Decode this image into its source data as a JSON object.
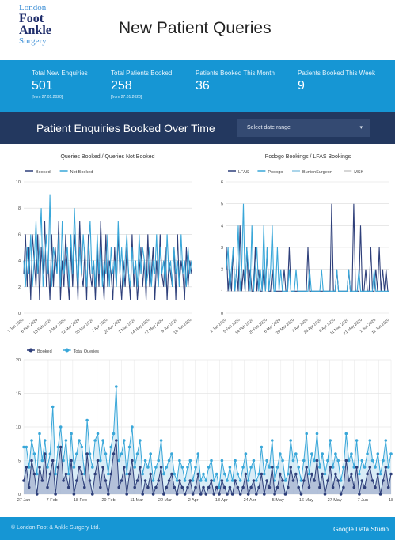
{
  "header": {
    "logo": {
      "line1": "London",
      "line2": "Foot",
      "line3": "Ankle",
      "line4": "Surgery"
    },
    "title": "New Patient Queries"
  },
  "kpis": [
    {
      "label": "Total New Enquiries",
      "value": "501",
      "sub": "[from 27.01.2020]"
    },
    {
      "label": "Total Patients Booked",
      "value": "258",
      "sub": "[from 27.01.2020]"
    },
    {
      "label": "Patients Booked This Month",
      "value": "36",
      "sub": ""
    },
    {
      "label": "Patients Booked This Week",
      "value": "9",
      "sub": ""
    }
  ],
  "banner": {
    "title": "Patient Enquiries Booked Over Time",
    "date_placeholder": "Select date range"
  },
  "footer": {
    "copyright": "© London Foot & Ankle Surgery Ltd.",
    "brand": "Google Data Studio"
  },
  "colors": {
    "dark_series": "#2e3f7a",
    "light_series": "#39a7d9",
    "kpi_bar": "#1696d4",
    "banner": "#23385f"
  },
  "chart_data": [
    {
      "type": "line",
      "title": "Queries Booked / Queries Not Booked",
      "ylim": [
        0,
        10
      ],
      "yticks": [
        0,
        2,
        4,
        6,
        8,
        10
      ],
      "xtick_labels": [
        "1 Jan 2020",
        "6 Feb 2020",
        "18 Feb 2020",
        "2 Mar 2020",
        "12 Mar 2020",
        "26 Mar 2020",
        "7 Apr 2020",
        "20 Apr 2020",
        "1 May 2020",
        "14 May 2020",
        "27 May 2020",
        "8 Jun 2020",
        "18 Jun 2020"
      ],
      "series": [
        {
          "name": "Booked",
          "color": "#2e3f7a",
          "values": [
            3,
            6,
            2,
            5,
            1,
            6,
            4,
            2,
            6,
            1,
            5,
            3,
            7,
            2,
            4,
            1,
            6,
            2,
            5,
            3,
            7,
            1,
            4,
            2,
            6,
            3,
            1,
            5,
            2,
            6,
            4,
            1,
            7,
            3,
            2,
            5,
            1,
            6,
            3,
            2,
            4,
            1,
            5,
            2,
            7,
            3,
            1,
            6,
            2,
            4,
            3,
            1,
            5,
            2,
            6,
            3,
            1,
            4,
            2,
            5,
            3,
            1,
            6,
            2,
            4,
            1,
            3,
            5,
            2,
            4,
            1,
            6,
            2,
            3,
            5,
            1,
            4,
            2,
            6,
            3,
            2,
            5,
            1,
            4,
            3,
            2,
            5,
            1,
            6,
            2,
            4,
            3,
            1,
            5,
            2,
            4,
            3
          ]
        },
        {
          "name": "Not Booked",
          "color": "#39a7d9",
          "values": [
            4,
            2,
            5,
            3,
            6,
            2,
            4,
            7,
            3,
            5,
            8,
            2,
            4,
            6,
            3,
            9,
            2,
            5,
            4,
            3,
            6,
            2,
            7,
            3,
            4,
            5,
            2,
            6,
            3,
            8,
            4,
            2,
            5,
            3,
            6,
            4,
            2,
            5,
            7,
            3,
            4,
            2,
            6,
            3,
            5,
            2,
            4,
            3,
            6,
            2,
            5,
            3,
            4,
            2,
            7,
            3,
            5,
            2,
            4,
            6,
            3,
            2,
            5,
            3,
            4,
            2,
            6,
            3,
            5,
            4,
            2,
            3,
            5,
            2,
            4,
            3,
            6,
            2,
            5,
            3,
            4,
            2,
            6,
            3,
            4,
            2,
            5,
            3,
            4,
            2,
            6,
            3,
            4,
            2,
            5,
            3,
            4
          ]
        }
      ]
    },
    {
      "type": "line",
      "title": "Podogo Bookings / LFAS Bookings",
      "ylim": [
        0,
        6
      ],
      "yticks": [
        0,
        1,
        2,
        3,
        4,
        5,
        6
      ],
      "xtick_labels": [
        "1 Jan 2020",
        "5 Feb 2020",
        "14 Feb 2020",
        "25 Feb 2020",
        "6 Mar 2020",
        "20 Mar 2020",
        "3 Apr 2020",
        "23 Apr 2020",
        "6 Apr 2020",
        "11 May 2020",
        "21 May 2020",
        "1 Jun 2020",
        "11 Jun 2020"
      ],
      "series": [
        {
          "name": "LFAS",
          "color": "#2e3f7a",
          "values": [
            3,
            1,
            2,
            1,
            3,
            1,
            2,
            1,
            4,
            1,
            2,
            1,
            3,
            1,
            2,
            1,
            1,
            3,
            1,
            2,
            1,
            1,
            2,
            1,
            3,
            1,
            1,
            2,
            1,
            1,
            1,
            1,
            1,
            1,
            2,
            1,
            1,
            3,
            1,
            1,
            1,
            1,
            1,
            1,
            1,
            1,
            1,
            1,
            3,
            1,
            1,
            1,
            1,
            1,
            1,
            1,
            1,
            1,
            1,
            1,
            1,
            1,
            5,
            1,
            1,
            2,
            1,
            1,
            1,
            1,
            1,
            1,
            2,
            1,
            1,
            5,
            1,
            1,
            1,
            4,
            1,
            1,
            2,
            1,
            1,
            3,
            1,
            1,
            2,
            1,
            3,
            1,
            2,
            1,
            2,
            1,
            1
          ]
        },
        {
          "name": "Podogo",
          "color": "#39a7d9",
          "values": [
            2,
            3,
            1,
            2,
            3,
            1,
            2,
            4,
            1,
            2,
            5,
            1,
            3,
            2,
            1,
            4,
            1,
            2,
            3,
            1,
            2,
            1,
            4,
            1,
            3,
            1,
            2,
            4,
            1,
            1,
            3,
            1,
            2,
            1,
            1,
            1,
            1,
            2,
            1,
            1,
            1,
            2,
            1,
            1,
            1,
            1,
            1,
            1,
            1,
            2,
            1,
            1,
            1,
            1,
            1,
            1,
            2,
            1,
            1,
            1,
            1,
            1,
            1,
            1,
            1,
            2,
            1,
            1,
            1,
            1,
            1,
            1,
            2,
            1,
            1,
            1,
            1,
            1,
            2,
            1,
            1,
            1,
            1,
            1,
            1,
            1,
            1,
            2,
            1,
            1,
            1,
            1,
            1,
            1,
            1,
            1,
            1
          ]
        },
        {
          "name": "BunionSurgeon",
          "color": "#8fc7e3",
          "values": []
        },
        {
          "name": "MSK",
          "color": "#c9c9c9",
          "values": []
        }
      ]
    },
    {
      "type": "area",
      "title": "",
      "ylim": [
        0,
        20
      ],
      "yticks": [
        0,
        5,
        10,
        15,
        20
      ],
      "xtick_labels": [
        "27 Jan",
        "7 Feb",
        "18 Feb",
        "29 Feb",
        "11 Mar",
        "22 Mar",
        "2 Apr",
        "13 Apr",
        "24 Apr",
        "5 May",
        "16 May",
        "27 May",
        "7 Jun",
        "18"
      ],
      "series": [
        {
          "name": "Booked",
          "color": "#2e3f7a",
          "values": [
            2,
            4,
            1,
            5,
            3,
            0,
            4,
            2,
            6,
            1,
            3,
            5,
            0,
            4,
            7,
            2,
            3,
            1,
            5,
            0,
            2,
            4,
            3,
            1,
            6,
            2,
            0,
            3,
            5,
            1,
            4,
            2,
            0,
            3,
            6,
            8,
            1,
            2,
            4,
            0,
            3,
            5,
            1,
            2,
            4,
            0,
            2,
            1,
            3,
            0,
            1,
            2,
            4,
            0,
            1,
            2,
            3,
            1,
            0,
            2,
            1,
            0,
            1,
            2,
            0,
            1,
            3,
            0,
            1,
            0,
            1,
            2,
            0,
            1,
            0,
            2,
            1,
            0,
            1,
            0,
            2,
            1,
            0,
            1,
            3,
            0,
            1,
            2,
            0,
            1,
            3,
            0,
            2,
            1,
            4,
            0,
            1,
            3,
            2,
            0,
            1,
            4,
            2,
            3,
            1,
            0,
            2,
            4,
            1,
            3,
            2,
            5,
            1,
            3,
            0,
            2,
            4,
            1,
            3,
            2,
            0,
            1,
            5,
            2,
            3,
            1,
            4,
            0,
            2,
            1,
            3,
            4,
            2,
            1,
            3,
            0,
            2,
            4,
            1,
            3
          ]
        },
        {
          "name": "Total Queries",
          "color": "#39a7d9",
          "values": [
            7,
            7,
            4,
            8,
            6,
            3,
            9,
            5,
            8,
            4,
            6,
            13,
            3,
            7,
            10,
            5,
            8,
            3,
            9,
            4,
            6,
            8,
            7,
            3,
            11,
            6,
            4,
            8,
            9,
            5,
            8,
            6,
            3,
            7,
            9,
            16,
            5,
            6,
            8,
            3,
            7,
            10,
            4,
            6,
            8,
            3,
            5,
            4,
            6,
            2,
            4,
            5,
            8,
            3,
            4,
            5,
            6,
            3,
            2,
            5,
            4,
            2,
            4,
            5,
            2,
            4,
            6,
            2,
            3,
            2,
            4,
            5,
            2,
            3,
            1,
            5,
            3,
            2,
            4,
            2,
            5,
            3,
            2,
            4,
            6,
            2,
            4,
            5,
            2,
            3,
            7,
            3,
            5,
            4,
            8,
            2,
            4,
            6,
            5,
            2,
            3,
            8,
            5,
            6,
            4,
            2,
            5,
            9,
            3,
            6,
            5,
            9,
            4,
            6,
            3,
            5,
            8,
            4,
            6,
            5,
            2,
            4,
            9,
            5,
            6,
            4,
            8,
            3,
            5,
            4,
            6,
            8,
            5,
            4,
            6,
            3,
            5,
            8,
            4,
            6
          ]
        }
      ]
    }
  ]
}
